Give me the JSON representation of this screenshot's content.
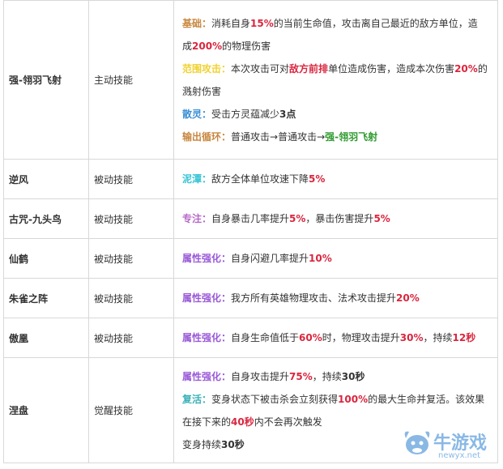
{
  "colors": {
    "accent_red": "#d9263e",
    "name_green": "#2e9a2e",
    "label_basic": "#c8873f",
    "label_aoe": "#f0d230",
    "label_disperse": "#3a8fd6",
    "label_cycle": "#c8873f",
    "label_mud": "#35c4d4",
    "label_focus": "#b768c8",
    "label_attr": "#9a5ad8",
    "label_revive": "#38b1b8"
  },
  "rows": [
    {
      "name": "强-翎羽飞射",
      "type": "主动技能",
      "lines": [
        {
          "label": "基础",
          "sep": "：",
          "p1": "消耗自身",
          "v1": "15%",
          "p2": "的当前生命值，攻击离自己最近的敌方单位，造"
        },
        {
          "p1": "成",
          "v1": "200%",
          "p2": "的物理伤害"
        },
        {
          "label": "范围攻击",
          "sep": "：",
          "p1": "本次攻击可对",
          "v1": "敌方前排",
          "p2": "单位造成伤害，造成本次伤害",
          "v2": "20%",
          "p3": "的"
        },
        {
          "p1": "溅射伤害"
        },
        {
          "label": "散灵",
          "sep": "：",
          "p1": "受击方灵蕴减少",
          "v1": "3点"
        },
        {
          "label": "输出循环",
          "sep": "：",
          "p1": "普通攻击→普通攻击→",
          "v1": "强-翎羽飞射"
        }
      ]
    },
    {
      "name": "逆风",
      "type": "被动技能",
      "lines": [
        {
          "label": "泥潭",
          "sep": "：",
          "p1": "敌方全体单位攻速下降",
          "v1": "5%"
        }
      ]
    },
    {
      "name": "古咒-九头鸟",
      "type": "被动技能",
      "lines": [
        {
          "label": "专注",
          "sep": "：",
          "p1": "自身暴击几率提升",
          "v1": "5%",
          "p2": "，暴击伤害提升",
          "v2": "5%"
        }
      ]
    },
    {
      "name": "仙鹤",
      "type": "被动技能",
      "lines": [
        {
          "label": "属性强化",
          "sep": "：",
          "p1": "自身闪避几率提升",
          "v1": "10%"
        }
      ]
    },
    {
      "name": "朱雀之阵",
      "type": "被动技能",
      "lines": [
        {
          "label": "属性强化",
          "sep": "：",
          "p1": "我方所有英雄物理攻击、法术攻击提升",
          "v1": "20%"
        }
      ]
    },
    {
      "name": "傲凰",
      "type": "被动技能",
      "lines": [
        {
          "label": "属性强化",
          "sep": "：",
          "p1": "自身生命值低于",
          "v1": "60%",
          "p2": "时，物理攻击提升",
          "v2": "30%",
          "p3": "，持续",
          "v3": "12秒"
        }
      ]
    },
    {
      "name": "涅盘",
      "type": "觉醒技能",
      "lines": [
        {
          "label": "属性强化",
          "sep": "：",
          "p1": "自身攻击提升",
          "v1": "75%",
          "p2": "，持续",
          "v2": "30秒"
        },
        {
          "label": "复活",
          "sep": "：",
          "p1": "变身状态下被击杀会立刻获得",
          "v1": "100%",
          "p2": "的最大生命并复活。该效果"
        },
        {
          "p1": "在接下来的",
          "v1": "40秒",
          "p2": "内不会再次触发"
        },
        {
          "p1": "变身持续",
          "v1": "30秒"
        }
      ]
    }
  ],
  "watermark": {
    "text": "牛游戏",
    "url": "newyx.net"
  }
}
